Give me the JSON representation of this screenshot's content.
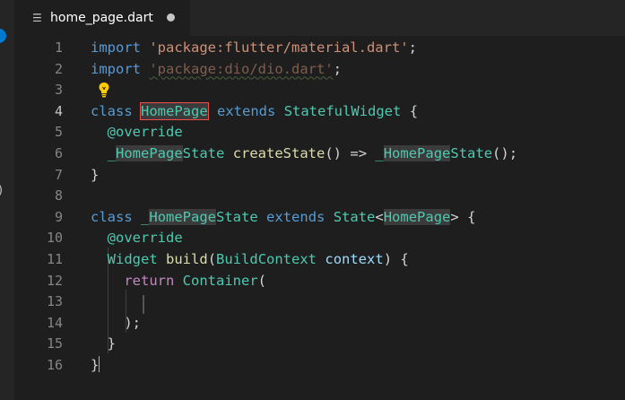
{
  "tab": {
    "icon": "lines-file-icon",
    "title": "home_page.dart",
    "dirty": true
  },
  "colors": {
    "background": "#1e1e1e",
    "keyword": "#569cd6",
    "string": "#ce9178",
    "type": "#4ec9b0",
    "function": "#dcdcaa",
    "variable": "#9cdcfe",
    "error_box": "#f14c4c",
    "lightbulb": "#ffcc00"
  },
  "gutter": {
    "line_numbers": [
      "1",
      "2",
      "3",
      "4",
      "5",
      "6",
      "7",
      "8",
      "9",
      "10",
      "11",
      "12",
      "13",
      "14",
      "15",
      "16"
    ],
    "active_line": "4"
  },
  "code": {
    "l1": {
      "kw": "import",
      "str": "'package:flutter/material.dart'",
      "end": ";"
    },
    "l2": {
      "kw": "import",
      "str": "'package:dio/dio.dart'",
      "end": ";"
    },
    "l4": {
      "kw": "class",
      "name": "HomePage",
      "ext": "extends",
      "base": "StatefulWidget",
      "brace": "{"
    },
    "l5": {
      "annot": "@override"
    },
    "l6": {
      "pre": "_",
      "name": "HomePage",
      "suffix": "State",
      "fn": "createState",
      "parens": "()",
      "arrow": "=>",
      "pre2": "_",
      "name2": "HomePage",
      "suffix2": "State",
      "end": "();"
    },
    "l7": {
      "brace": "}"
    },
    "l9": {
      "kw": "class",
      "pre": "_",
      "name": "HomePage",
      "suffix": "State",
      "ext": "extends",
      "base": "State",
      "lt": "<",
      "generic": "HomePage",
      "gt": ">",
      "brace": "{"
    },
    "l10": {
      "annot": "@override"
    },
    "l11": {
      "type": "Widget",
      "fn": "build",
      "open": "(",
      "ptype": "BuildContext",
      "param": "context",
      "close": ")",
      "brace": "{"
    },
    "l12": {
      "kw": "return",
      "type": "Container",
      "open": "("
    },
    "l14": {
      "end": ");"
    },
    "l15": {
      "brace": "}"
    },
    "l16": {
      "brace": "}"
    }
  }
}
